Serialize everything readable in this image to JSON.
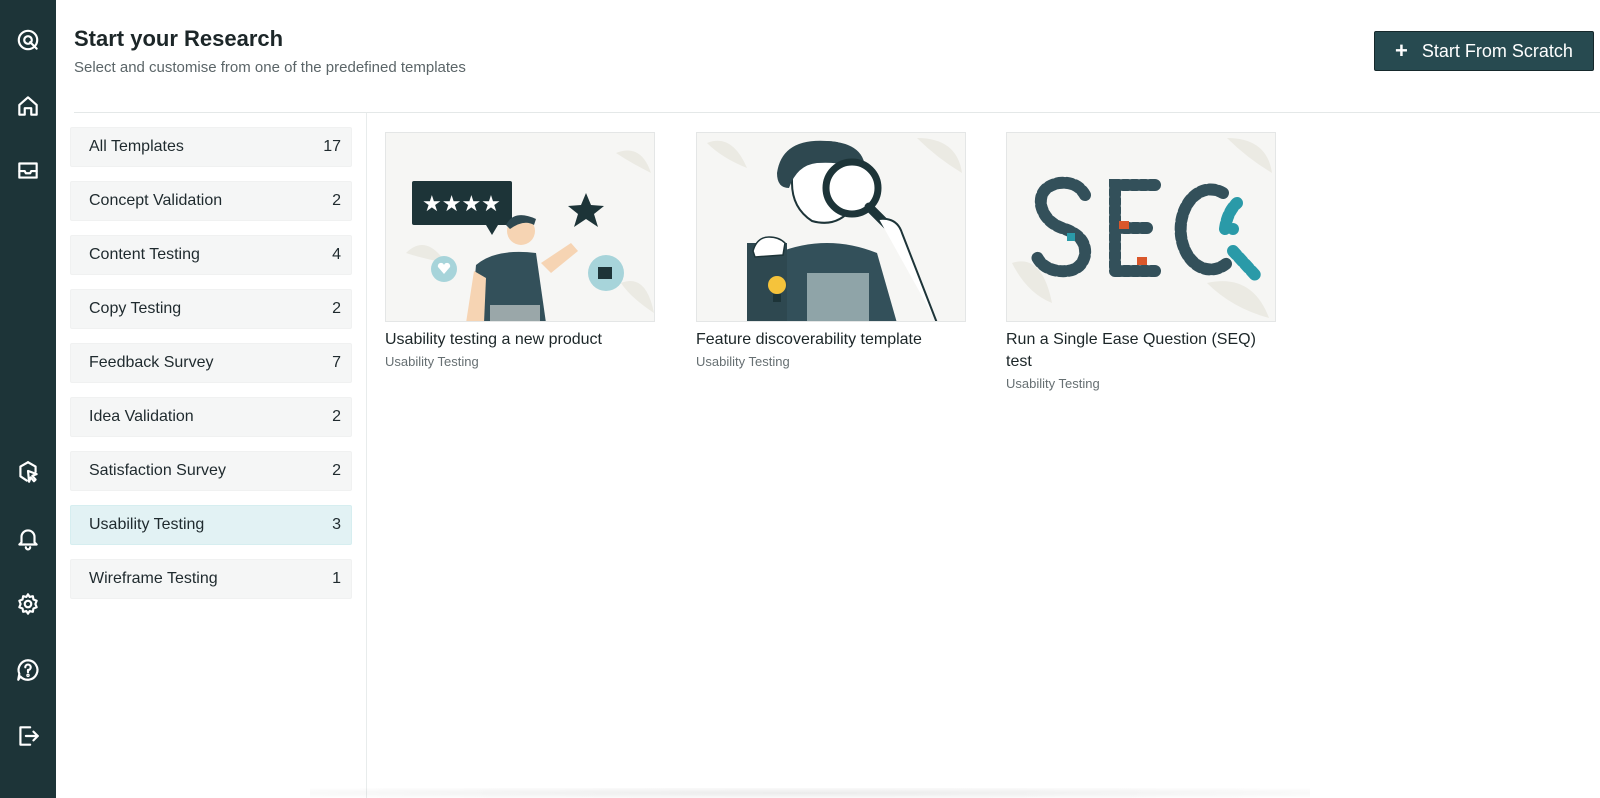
{
  "header": {
    "title": "Start your Research",
    "subtitle": "Select and customise from one of the predefined templates",
    "start_button_label": "Start From Scratch"
  },
  "nav_icons": [
    "logo-icon",
    "home-icon",
    "inbox-icon",
    "cursor-click-icon",
    "bell-icon",
    "gear-icon",
    "help-icon",
    "logout-icon"
  ],
  "categories": [
    {
      "label": "All Templates",
      "count": "17"
    },
    {
      "label": "Concept Validation",
      "count": "2"
    },
    {
      "label": "Content Testing",
      "count": "4"
    },
    {
      "label": "Copy Testing",
      "count": "2"
    },
    {
      "label": "Feedback Survey",
      "count": "7"
    },
    {
      "label": "Idea Validation",
      "count": "2"
    },
    {
      "label": "Satisfaction Survey",
      "count": "2"
    },
    {
      "label": "Usability Testing",
      "count": "3",
      "selected": true
    },
    {
      "label": "Wireframe Testing",
      "count": "1"
    }
  ],
  "templates": [
    {
      "title": "Usability testing a new product",
      "tag": "Usability Testing"
    },
    {
      "title": "Feature discoverability template",
      "tag": "Usability Testing"
    },
    {
      "title": "Run a Single Ease Question (SEQ) test",
      "tag": "Usability Testing"
    }
  ],
  "colors": {
    "rail": "#1d3438",
    "button": "#274a50",
    "selected_category": "#e2f2f4",
    "category_bg": "#f5f6f6"
  }
}
